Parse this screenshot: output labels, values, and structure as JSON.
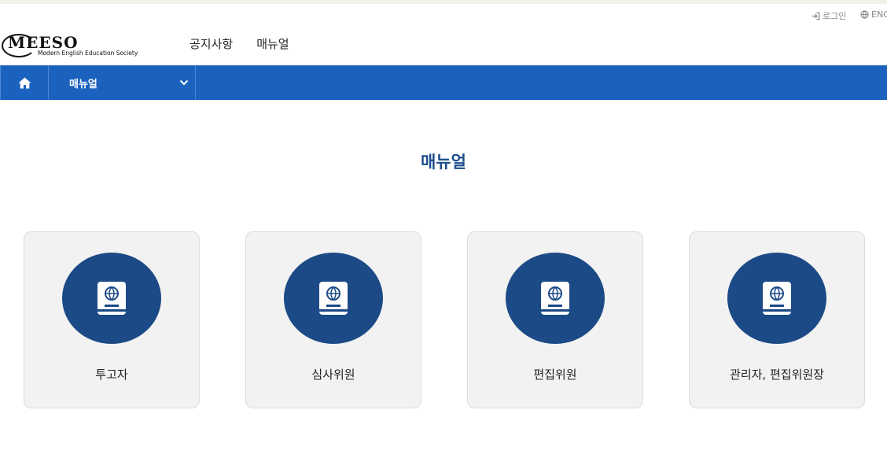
{
  "util": {
    "login": "로그인",
    "lang": "ENG"
  },
  "logo": {
    "mark": "MEESO",
    "subtitle": "Modern English Education Society"
  },
  "nav": {
    "items": [
      "공지사항",
      "매뉴얼"
    ]
  },
  "breadcrumb": {
    "current": "매뉴얼"
  },
  "page": {
    "title": "매뉴얼"
  },
  "cards": [
    {
      "label": "투고자",
      "icon": "manual-book-icon"
    },
    {
      "label": "심사위원",
      "icon": "manual-book-icon"
    },
    {
      "label": "편집위원",
      "icon": "manual-book-icon"
    },
    {
      "label": "관리자, 편집위원장",
      "icon": "manual-book-icon"
    }
  ],
  "colors": {
    "primary_bar": "#1b62be",
    "title_text": "#1c4d8c",
    "icon_circle": "#1c4a86",
    "card_bg": "#f2f2f2"
  }
}
